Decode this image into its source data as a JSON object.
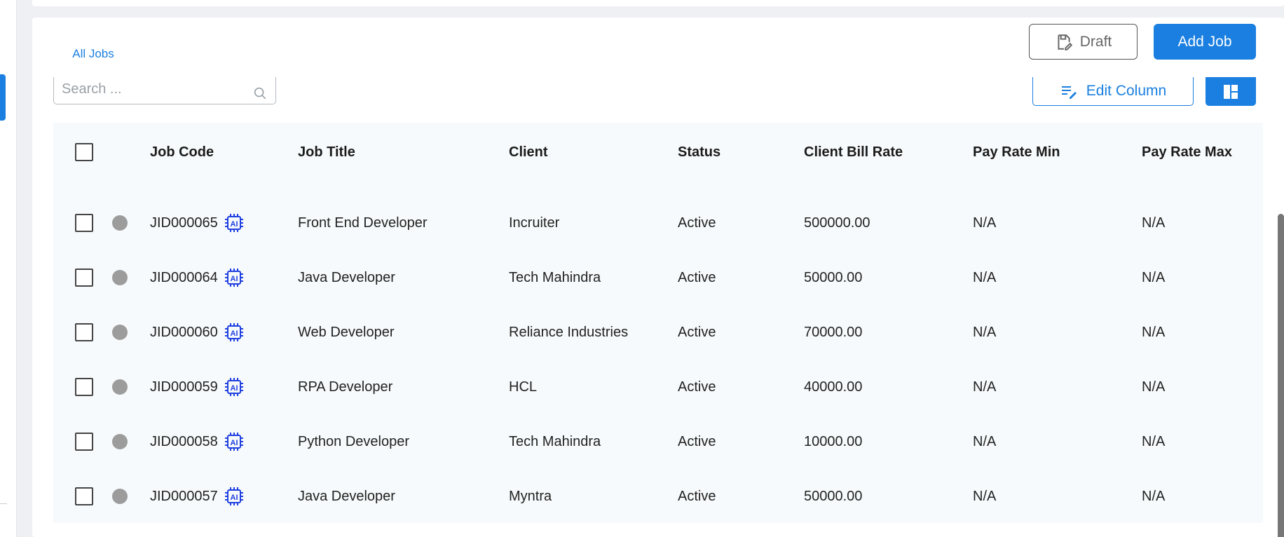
{
  "tabs": [
    {
      "label": "All Jobs",
      "active": true
    }
  ],
  "toolbar": {
    "draft_label": "Draft",
    "add_job_label": "Add Job",
    "edit_column_label": "Edit Column",
    "search_placeholder": "Search ..."
  },
  "table": {
    "columns": [
      "Job Code",
      "Job Title",
      "Client",
      "Status",
      "Client Bill Rate",
      "Pay Rate Min",
      "Pay Rate Max"
    ],
    "rows": [
      {
        "code": "JID000065",
        "title": "Front End Developer",
        "client": "Incruiter",
        "status": "Active",
        "bill_rate": "500000.00",
        "pay_min": "N/A",
        "pay_max": "N/A"
      },
      {
        "code": "JID000064",
        "title": "Java Developer",
        "client": "Tech Mahindra",
        "status": "Active",
        "bill_rate": "50000.00",
        "pay_min": "N/A",
        "pay_max": "N/A"
      },
      {
        "code": "JID000060",
        "title": "Web Developer",
        "client": "Reliance Industries",
        "status": "Active",
        "bill_rate": "70000.00",
        "pay_min": "N/A",
        "pay_max": "N/A"
      },
      {
        "code": "JID000059",
        "title": "RPA Developer",
        "client": "HCL",
        "status": "Active",
        "bill_rate": "40000.00",
        "pay_min": "N/A",
        "pay_max": "N/A"
      },
      {
        "code": "JID000058",
        "title": "Python Developer",
        "client": "Tech Mahindra",
        "status": "Active",
        "bill_rate": "10000.00",
        "pay_min": "N/A",
        "pay_max": "N/A"
      },
      {
        "code": "JID000057",
        "title": "Java Developer",
        "client": "Myntra",
        "status": "Active",
        "bill_rate": "50000.00",
        "pay_min": "N/A",
        "pay_max": "N/A"
      }
    ]
  },
  "icons": {
    "draft": "draft-save-icon",
    "edit_column": "edit-list-icon",
    "layout": "grid-layout-icon",
    "search": "search-icon",
    "ai": "ai-chip-icon"
  },
  "colors": {
    "accent": "#1a7fe0",
    "ai_icon": "#1f3fe0",
    "status_dot": "#9c9c9c",
    "table_bg": "#f7fafc"
  }
}
